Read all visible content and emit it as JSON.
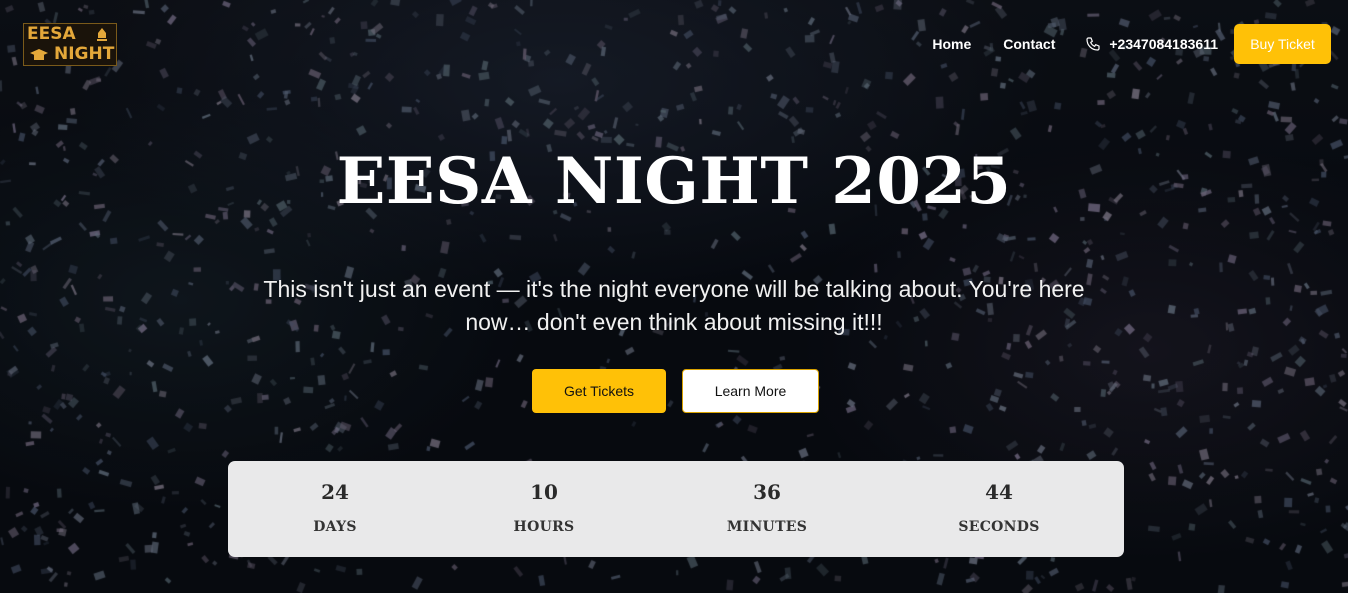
{
  "logo": {
    "line1": "EESA",
    "line2": "NIGHT"
  },
  "nav": {
    "home": "Home",
    "contact": "Contact",
    "phone": "+2347084183611",
    "buy_ticket": "Buy Ticket"
  },
  "hero": {
    "title": "EESA NIGHT 2025",
    "subtitle_line1": "This isn't just an event — it's the night everyone will be talking about. You're here",
    "subtitle_line2": "now… don't even think about missing it!!!",
    "get_tickets": "Get Tickets",
    "learn_more": "Learn More"
  },
  "countdown": [
    {
      "value": "24",
      "label": "DAYS"
    },
    {
      "value": "10",
      "label": "HOURS"
    },
    {
      "value": "36",
      "label": "MINUTES"
    },
    {
      "value": "44",
      "label": "SECONDS"
    }
  ],
  "colors": {
    "accent": "#ffc107",
    "countdown_bg": "#e9e9ea",
    "logo_gold": "#e4a83a"
  },
  "icons": {
    "phone": "phone-icon"
  }
}
